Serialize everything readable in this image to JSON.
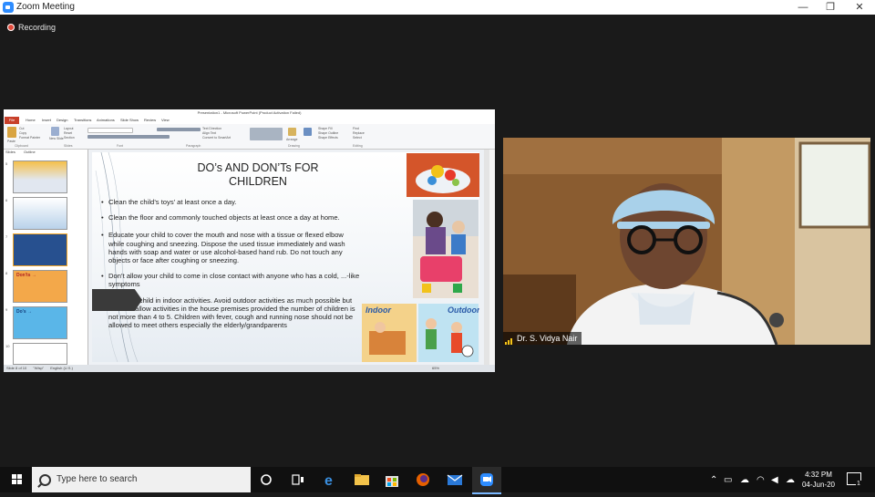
{
  "window": {
    "title": "Zoom Meeting",
    "minimize": "—",
    "restore": "❐",
    "close": "✕"
  },
  "recording": {
    "label": "Recording"
  },
  "powerpoint": {
    "title_bar": "Presentation1 - Microsoft PowerPoint (Product Activation Failed)",
    "file_tab": "File",
    "tabs": [
      "Home",
      "Insert",
      "Design",
      "Transitions",
      "Animations",
      "Slide Show",
      "Review",
      "View"
    ],
    "ribbon": {
      "clipboard": {
        "cut": "Cut",
        "copy": "Copy",
        "format_painter": "Format Painter",
        "paste": "Paste",
        "group": "Clipboard"
      },
      "slides": {
        "new_slide": "New Slide",
        "layout": "Layout",
        "reset": "Reset",
        "section": "Section",
        "group": "Slides"
      },
      "font_group": "Font",
      "paragraph": {
        "text_direction": "Text Direction",
        "align_text": "Align Text",
        "convert": "Convert to SmartArt",
        "group": "Paragraph"
      },
      "drawing": {
        "arrange": "Arrange",
        "quick_styles": "Quick Styles",
        "shape_fill": "Shape Fill",
        "shape_outline": "Shape Outline",
        "shape_effects": "Shape Effects",
        "group": "Drawing"
      },
      "editing": {
        "find": "Find",
        "replace": "Replace",
        "select": "Select",
        "group": "Editing"
      }
    },
    "pane_tabs": [
      "Slides",
      "Outline"
    ],
    "thumb_numbers": [
      "5",
      "6",
      "7",
      "8",
      "9",
      "10"
    ],
    "thumb_labels": {
      "donts": "Don'ts →",
      "dos": "Do's →"
    },
    "slide": {
      "title_line1": "DO’s AND DON’Ts FOR",
      "title_line2": "CHILDREN",
      "bullets": [
        "Clean the child’s toys’ at least once a day.",
        "Clean the floor and commonly touched objects at least once a day at home.",
        "Educate your child to cover the mouth and nose with a tissue or flexed elbow while coughing and sneezing. Dispose the used tissue immediately and wash hands with soap and water or use alcohol-based hand rub. Do not touch any objects or face after coughing or sneezing.",
        "Don’t allow your child to come in close contact with anyone who has a cold, ...-like symptoms",
        "...ge your child in indoor activities. Avoid outdoor activities as much possible but one can allow activities in the house premises provided the number of children is not more than 4 to 5. Children with fever, cough and running nose should not be allowed to meet others especially the elderly/grandparents"
      ],
      "indoor_label": "Indoor",
      "outdoor_label": "Outdoor"
    },
    "status": {
      "slide_info": "Slide 8 of 10",
      "theme": "\"Wisp\"",
      "language": "English (U.S.)",
      "zoom": "65%"
    }
  },
  "camera": {
    "participant_name": "Dr. S. Vidya Nair"
  },
  "taskbar": {
    "search_placeholder": "Type here to search",
    "time": "4:32 PM",
    "date": "04-Jun-20",
    "notification_count": "1"
  },
  "colors": {
    "zoom_blue": "#2d8cff",
    "ppt_red": "#c8402a",
    "recording_red": "#e04a3b"
  }
}
